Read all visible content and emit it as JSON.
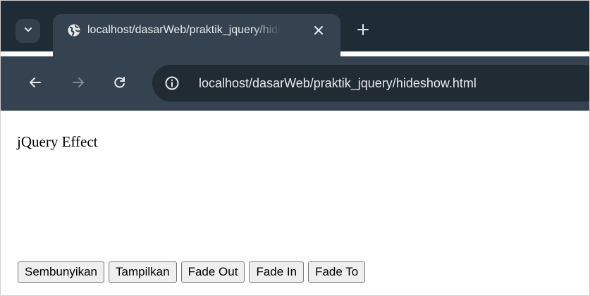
{
  "browser": {
    "tab": {
      "title": "localhost/dasarWeb/praktik_jquery/hideshow.html",
      "favicon": "globe-icon"
    },
    "address_bar": {
      "url": "localhost/dasarWeb/praktik_jquery/hideshow.html",
      "info_icon": "info-icon"
    },
    "nav": {
      "back_icon": "back-arrow-icon",
      "forward_icon": "forward-arrow-icon",
      "reload_icon": "reload-icon"
    },
    "colors": {
      "chrome_dark": "#1f2b35",
      "chrome_toolbar": "#34434f",
      "omnibox": "#202b34",
      "chrome_text": "#e8eaed"
    }
  },
  "page": {
    "heading": "jQuery Effect",
    "buttons": [
      "Sembunyikan",
      "Tampilkan",
      "Fade Out",
      "Fade In",
      "Fade To"
    ]
  }
}
